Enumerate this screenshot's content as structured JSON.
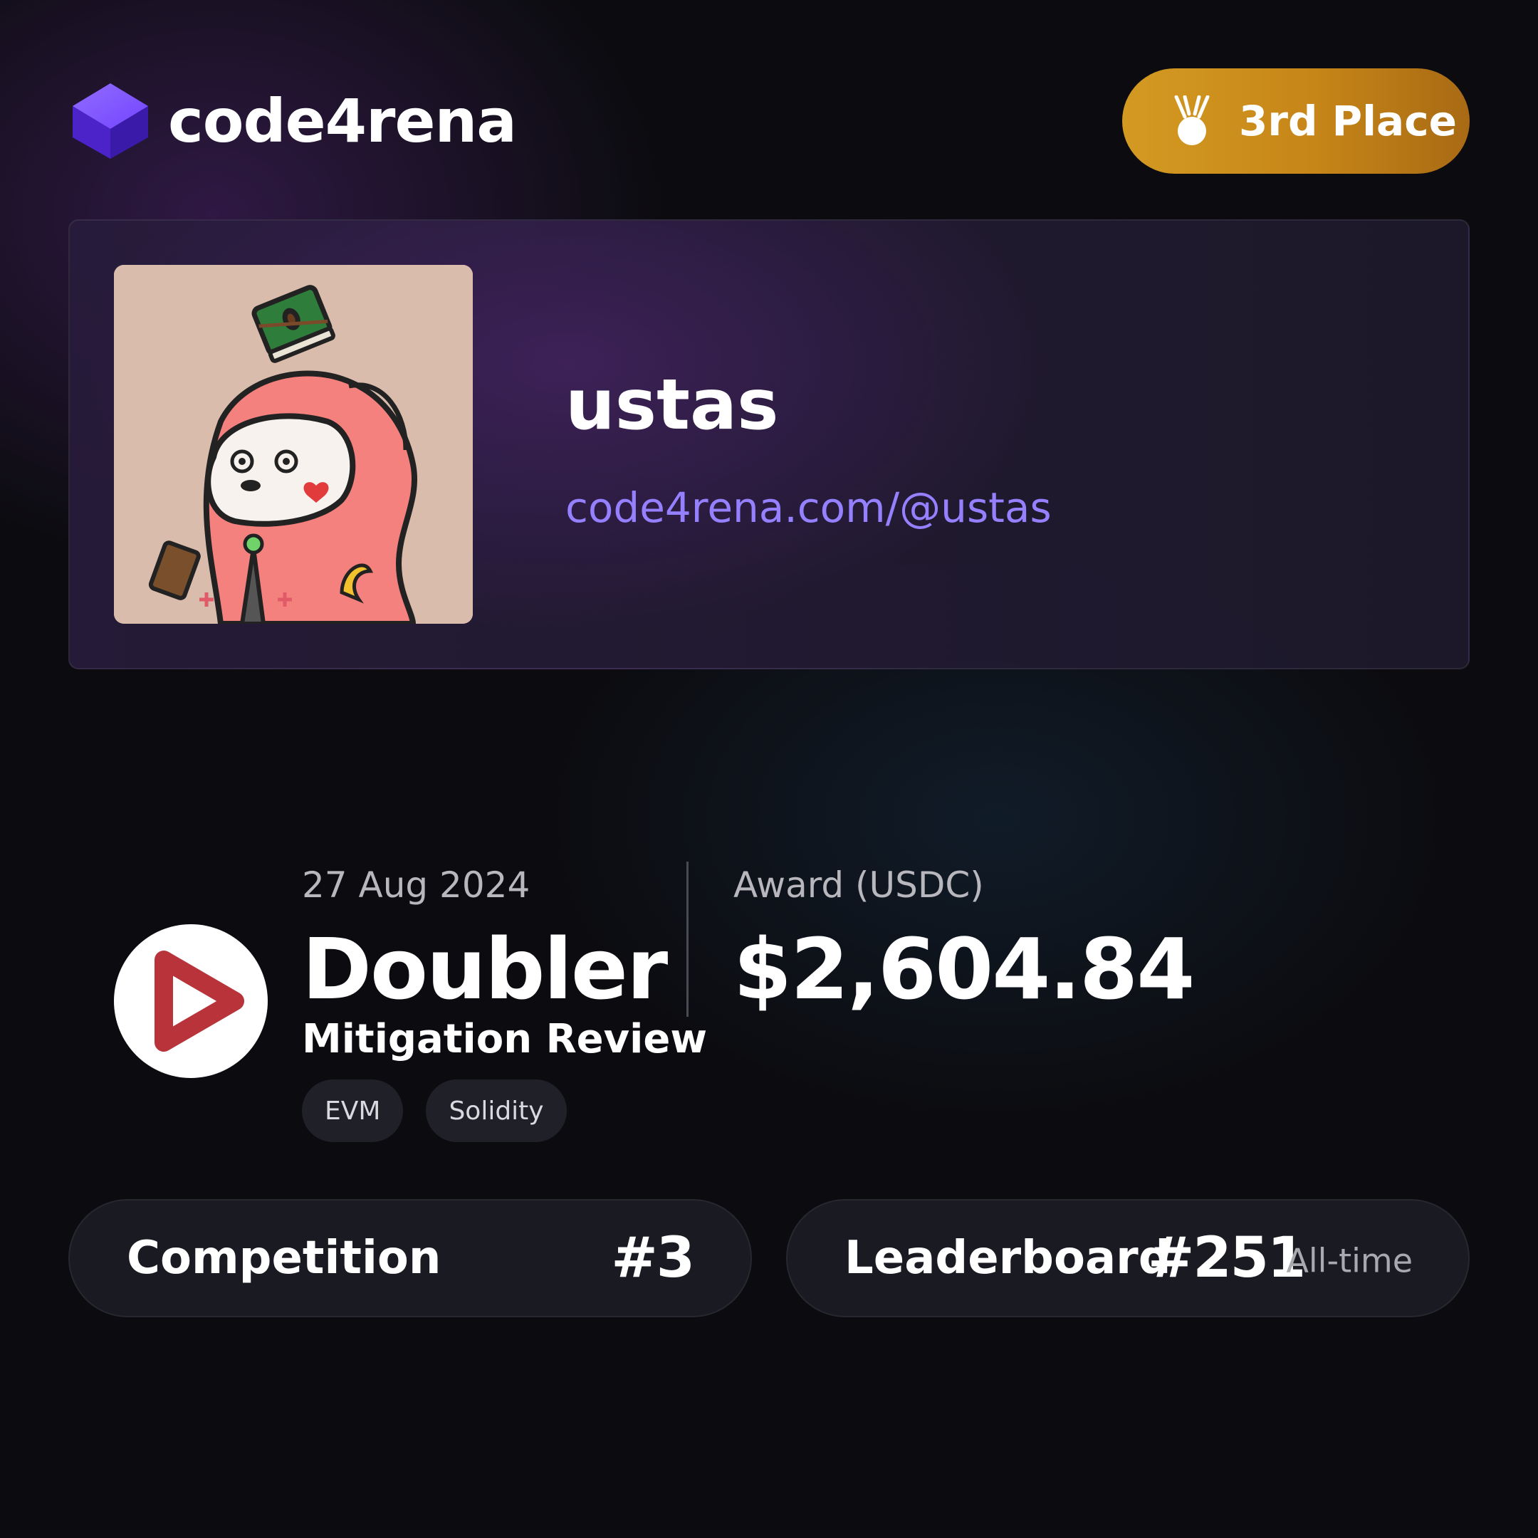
{
  "header": {
    "brand_name": "code4rena",
    "place_badge": "3rd Place",
    "badge_color": "#C98A1C",
    "brand_color": "#7B4DFF"
  },
  "profile": {
    "username": "ustas",
    "profile_url": "code4rena.com/@ustas",
    "link_color": "#9580FF"
  },
  "contest": {
    "date": "27 Aug 2024",
    "name": "Doubler",
    "type": "Mitigation Review",
    "tags": [
      "EVM",
      "Solidity"
    ],
    "logo_color": "#B8343A"
  },
  "award": {
    "label": "Award (USDC)",
    "value": "$2,604.84"
  },
  "stats": {
    "competition": {
      "label": "Competition",
      "rank": "#3"
    },
    "leaderboard": {
      "label": "Leaderboard",
      "rank": "#251",
      "note": "All-time"
    }
  }
}
